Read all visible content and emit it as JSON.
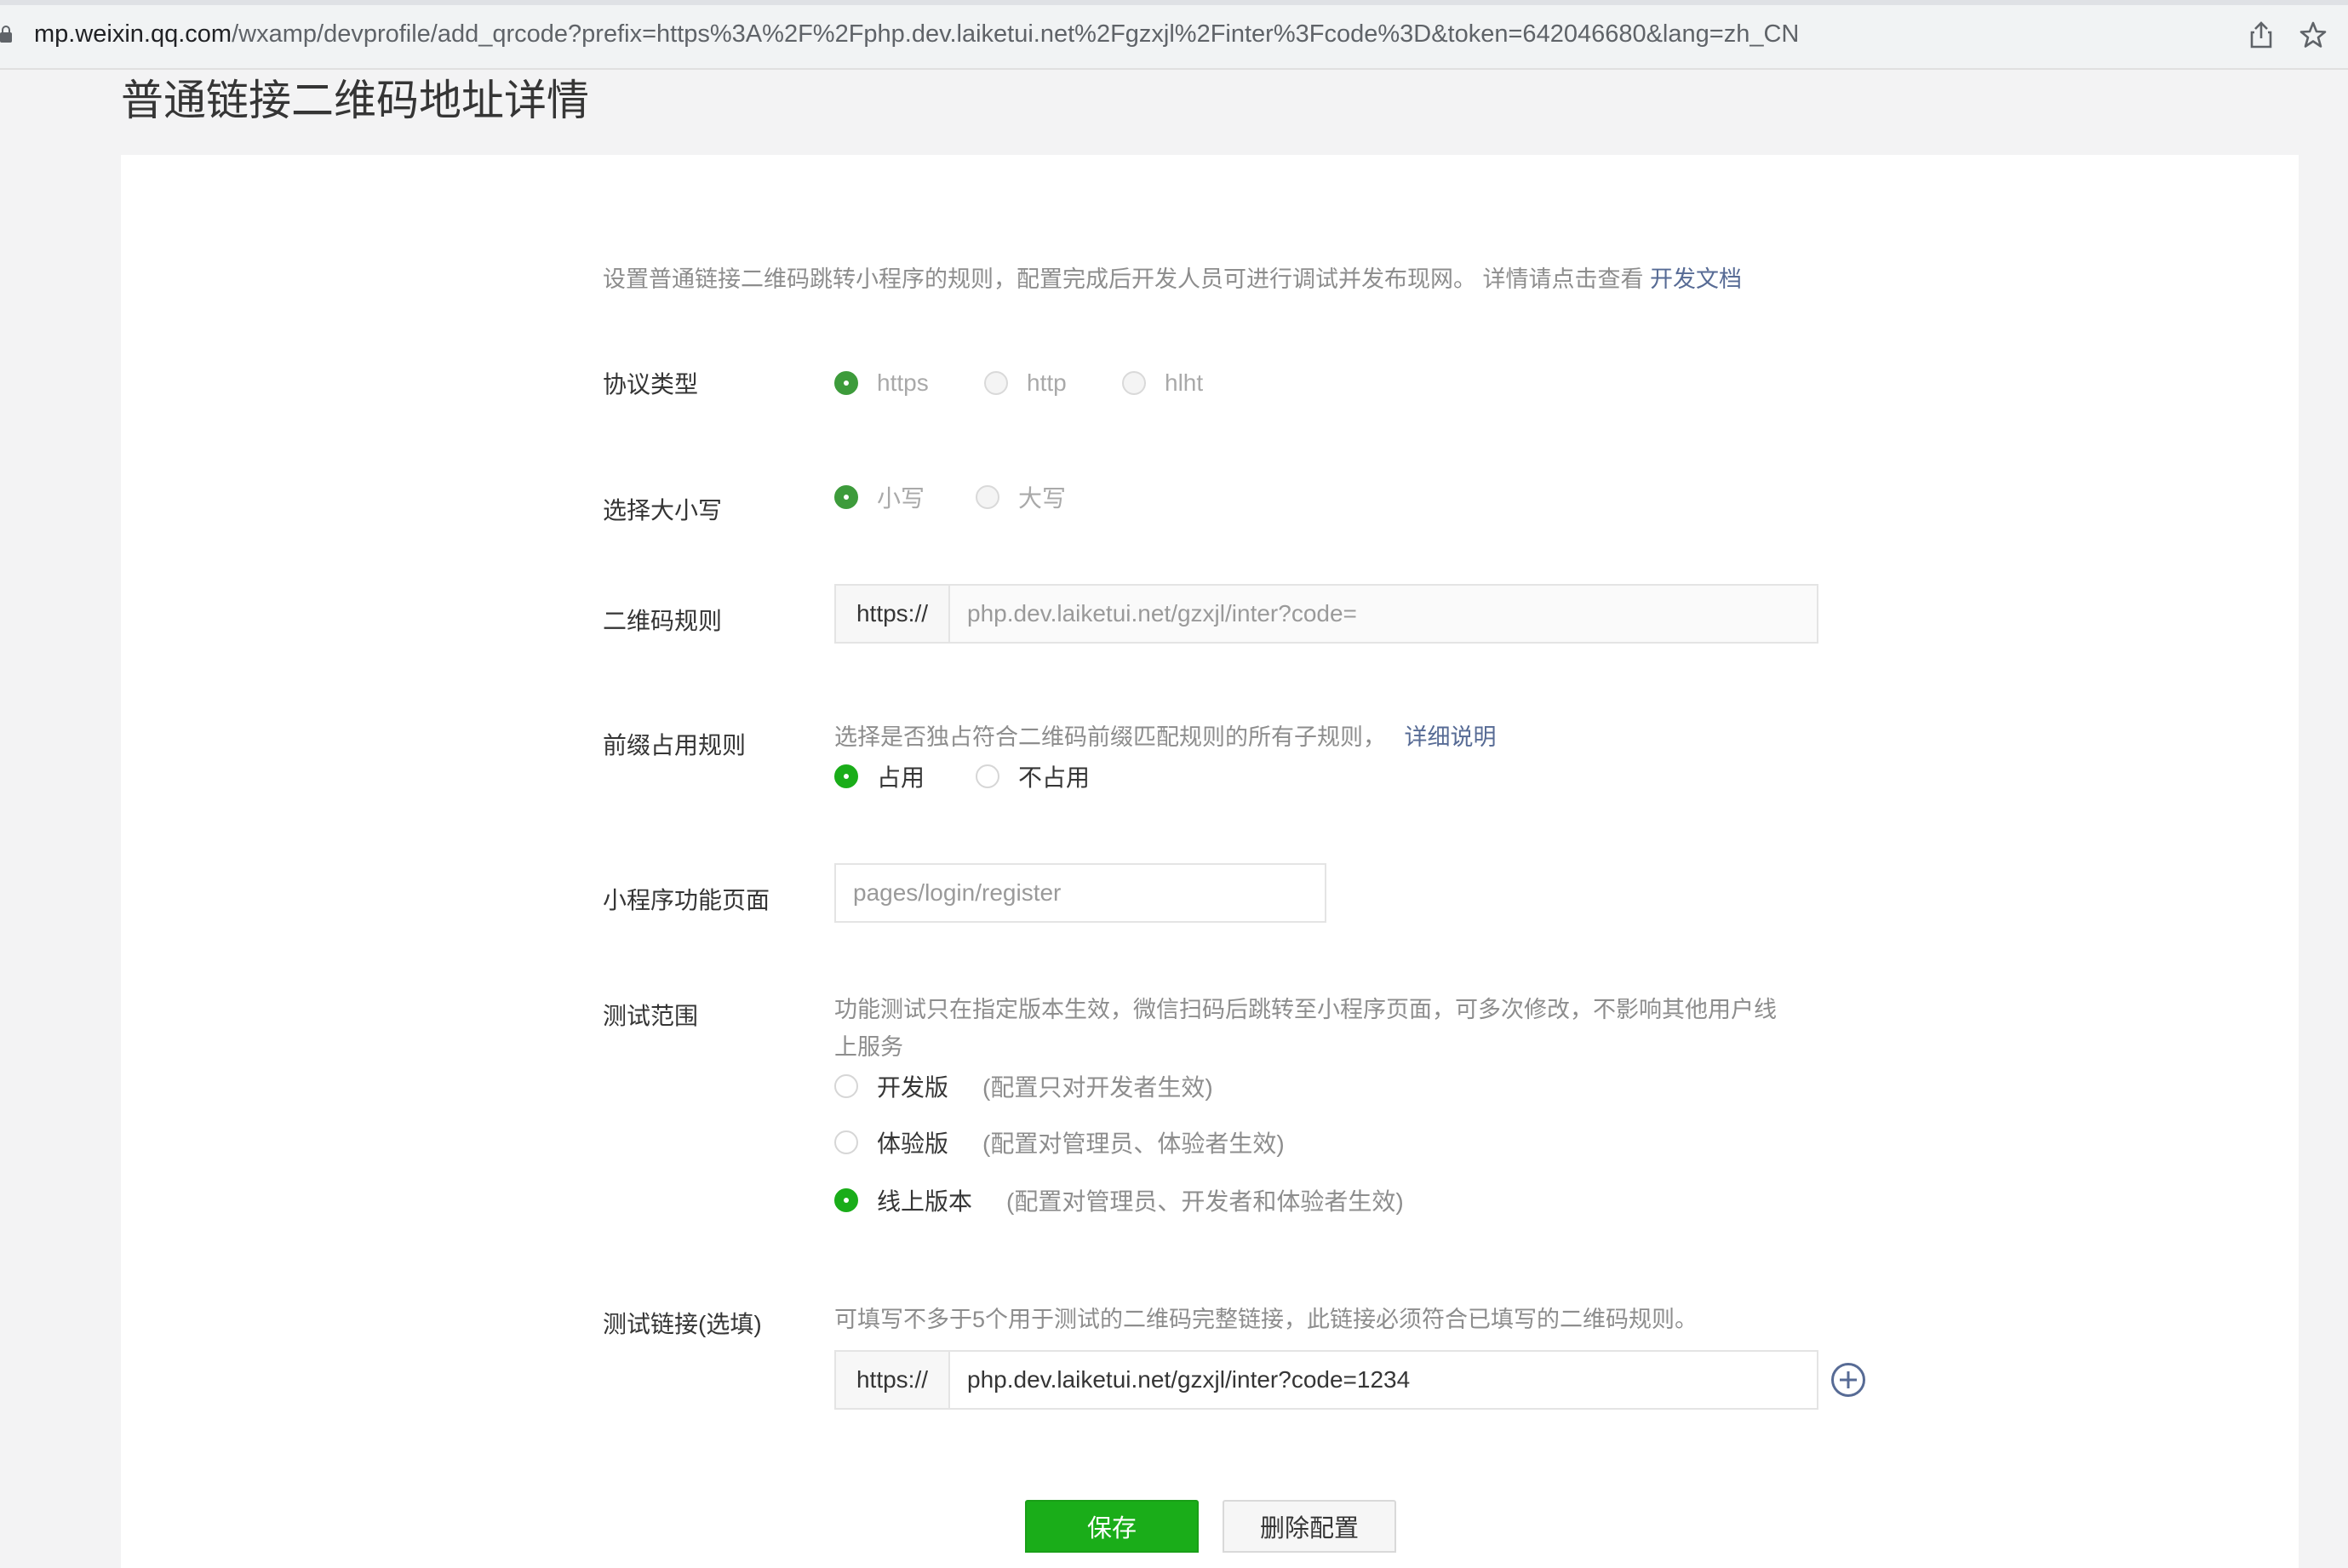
{
  "browser": {
    "url_host": "mp.weixin.qq.com",
    "url_path": "/wxamp/devprofile/add_qrcode?prefix=https%3A%2F%2Fphp.dev.laiketui.net%2Fgzxjl%2Finter%3Fcode%3D&token=642046680&lang=zh_CN"
  },
  "page": {
    "title": "普通链接二维码地址详情",
    "description": "设置普通链接二维码跳转小程序的规则，配置完成后开发人员可进行调试并发布现网。 详情请点击查看",
    "description_link": "开发文档"
  },
  "form": {
    "protocol": {
      "label": "协议类型",
      "options": [
        "https",
        "http",
        "hlht"
      ],
      "selected": "https"
    },
    "case": {
      "label": "选择大小写",
      "options": [
        "小写",
        "大写"
      ],
      "selected": "小写"
    },
    "qr_rule": {
      "label": "二维码规则",
      "prefix": "https://",
      "value": "php.dev.laiketui.net/gzxjl/inter?code="
    },
    "prefix_rule": {
      "label": "前缀占用规则",
      "hint": "选择是否独占符合二维码前缀匹配规则的所有子规则，",
      "hint_link": "详细说明",
      "options": [
        "占用",
        "不占用"
      ],
      "selected": "占用"
    },
    "mini_page": {
      "label": "小程序功能页面",
      "value": "pages/login/register"
    },
    "test_scope": {
      "label": "测试范围",
      "hint_line1": "功能测试只在指定版本生效，微信扫码后跳转至小程序页面，可多次修改，不影响其他用户线",
      "hint_line2": "上服务",
      "options": [
        {
          "name": "开发版",
          "note": "(配置只对开发者生效)"
        },
        {
          "name": "体验版",
          "note": "(配置对管理员、体验者生效)"
        },
        {
          "name": "线上版本",
          "note": "(配置对管理员、开发者和体验者生效)"
        }
      ],
      "selected": "线上版本"
    },
    "test_link": {
      "label": "测试链接(选填)",
      "hint": "可填写不多于5个用于测试的二维码完整链接，此链接必须符合已填写的二维码规则。",
      "prefix": "https://",
      "value": "php.dev.laiketui.net/gzxjl/inter?code=1234"
    }
  },
  "buttons": {
    "save": "保存",
    "delete": "删除配置"
  },
  "colors": {
    "accent": "#1aad19",
    "link": "#576b95"
  }
}
